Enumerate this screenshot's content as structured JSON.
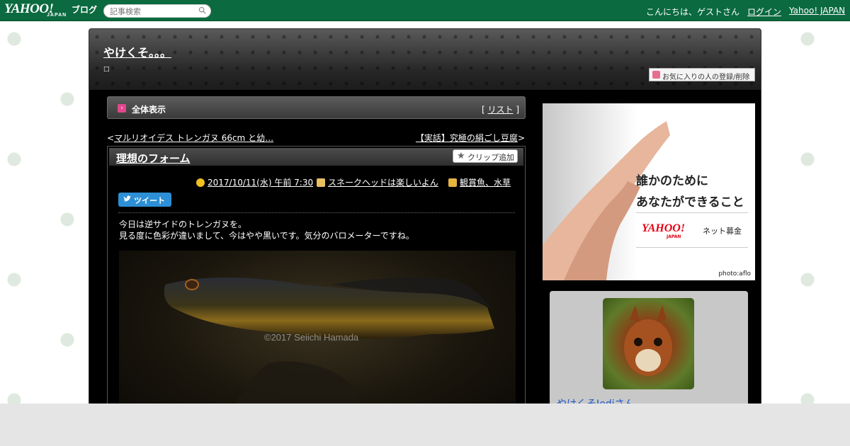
{
  "topbar": {
    "logo_text": "YAHOO!",
    "logo_sub": "JAPAN",
    "logo_blog": "ブログ",
    "search_placeholder": "記事検索",
    "greeting": "こんにちは、ゲストさん",
    "login_label": "ログイン",
    "yahoo_japan_label": "Yahoo! JAPAN"
  },
  "header": {
    "blog_title": "やけくそ。。。",
    "blog_desc": "□",
    "favorite_label": "お気に入りの人の登録/削除"
  },
  "content": {
    "all_view_label": "全体表示",
    "list_label": "リスト",
    "prev_article": "マルリオイデス トレンガヌ 66cm と幼…",
    "next_article": "【実話】究極の絹ごし豆腐",
    "entry": {
      "title": "理想のフォーム",
      "clip_label": "クリップ追加",
      "date": "2017/10/11(水) 午前 7:30",
      "theme": "スネークヘッドは楽しいよん",
      "category": "観賞魚、水草",
      "tweet_label": "ツイート",
      "body": [
        "今日は逆サイドのトレンガヌを。",
        "見る度に色彩が違いまして、今はやや黒いです。気分のバロメーターですね。"
      ],
      "photo_watermark": "©2017 Seiichi Hamada"
    }
  },
  "sidebar": {
    "ad": {
      "line1": "誰かのために",
      "line2": "あなたができること",
      "brand": "YAHOO!",
      "brand_sub": "JAPAN",
      "service": "ネット募金",
      "credit": "photo:aflo"
    },
    "profile": {
      "name": "やけくそJediさん"
    }
  },
  "colors": {
    "topbar_bg": "#0b6a3f",
    "link_blue": "#1a55c8",
    "accent_pink": "#e2478d",
    "tweet_blue": "#2d8fd5"
  }
}
